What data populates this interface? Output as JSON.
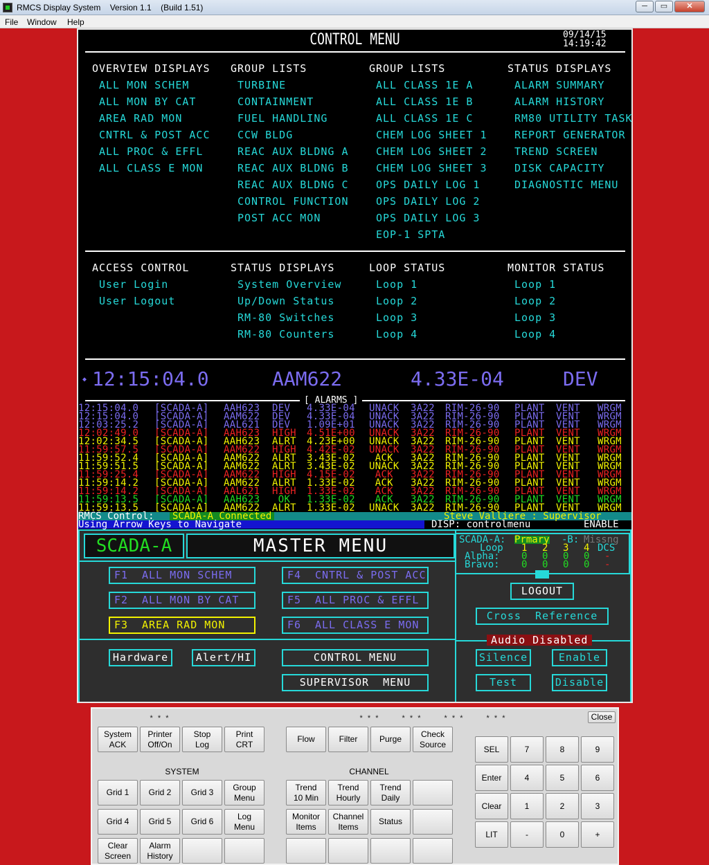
{
  "window": {
    "title": "RMCS Display System    Version 1.1    (Build 1.51)",
    "minimize": "─",
    "restore": "▭",
    "close": "✕"
  },
  "menu": [
    "File",
    "Window",
    "Help"
  ],
  "control": {
    "title": "CONTROL MENU",
    "date": "09/14/15",
    "time": "14:19:42",
    "columns": [
      {
        "header": "OVERVIEW DISPLAYS",
        "items": [
          "ALL MON SCHEM",
          "ALL MON BY CAT",
          "AREA RAD MON",
          "CNTRL & POST ACC",
          "ALL PROC & EFFL",
          "ALL CLASS E MON"
        ]
      },
      {
        "header": "GROUP LISTS",
        "items": [
          "TURBINE",
          "CONTAINMENT",
          "FUEL HANDLING",
          "CCW BLDG",
          "REAC AUX BLDNG A",
          "REAC AUX BLDNG B",
          "REAC AUX BLDNG C",
          "CONTROL FUNCTION",
          "POST ACC MON"
        ]
      },
      {
        "header": "GROUP LISTS",
        "items": [
          "ALL CLASS 1E A",
          "ALL CLASS 1E B",
          "ALL CLASS 1E C",
          "CHEM LOG SHEET 1",
          "CHEM LOG SHEET 2",
          "CHEM LOG SHEET 3",
          "OPS DAILY LOG 1",
          "OPS DAILY LOG 2",
          "OPS DAILY LOG 3",
          "EOP-1 SPTA"
        ]
      },
      {
        "header": "STATUS DISPLAYS",
        "items": [
          "ALARM SUMMARY",
          "ALARM HISTORY",
          "RM80 UTILITY TASK",
          "REPORT GENERATOR",
          "TREND SCREEN",
          "DISK CAPACITY",
          "DIAGNOSTIC MENU"
        ]
      }
    ],
    "columns2": [
      {
        "header": "ACCESS CONTROL",
        "items": [
          "User Login",
          "User Logout"
        ]
      },
      {
        "header": "STATUS DISPLAYS",
        "items": [
          "System Overview",
          "Up/Down Status",
          "RM-80 Switches",
          "RM-80 Counters"
        ]
      },
      {
        "header": "LOOP STATUS",
        "items": [
          "Loop 1",
          "Loop 2",
          "Loop 3",
          "Loop 4"
        ]
      },
      {
        "header": "MONITOR STATUS",
        "items": [
          "Loop 1",
          "Loop 2",
          "Loop 3",
          "Loop 4"
        ]
      }
    ]
  },
  "current": {
    "time": "12:15:04.0",
    "point": "AAM622",
    "value": "4.33E-04",
    "state": "DEV"
  },
  "alarms_title": "[ ALARMS ]",
  "alarms": [
    {
      "t": "12:15:04.0",
      "src": "[SCADA-A]",
      "pt": "AAH623",
      "st": "DEV ",
      "val": "4.33E-04",
      "ack": "UNACK",
      "ch": "3A22",
      "mon": "RIM-26-90",
      "a1": "PLANT",
      "a2": "VENT",
      "a3": "WRGM",
      "color": "#7b6cf0"
    },
    {
      "t": "12:15:04.0",
      "src": "[SCADA-A]",
      "pt": "AAM622",
      "st": "DEV ",
      "val": "4.33E-04",
      "ack": "UNACK",
      "ch": "3A22",
      "mon": "RIM-26-90",
      "a1": "PLANT",
      "a2": "VENT",
      "a3": "WRGM",
      "color": "#7b6cf0"
    },
    {
      "t": "12:03:25.2",
      "src": "[SCADA-A]",
      "pt": "AAL621",
      "st": "DEV ",
      "val": "1.09E+01",
      "ack": "UNACK",
      "ch": "3A22",
      "mon": "RIM-26-90",
      "a1": "PLANT",
      "a2": "VENT",
      "a3": "WRGM",
      "color": "#7b6cf0"
    },
    {
      "t": "12:02:49.0",
      "src": "[SCADA-A]",
      "pt": "AAH623",
      "st": "HIGH",
      "val": "4.51E+00",
      "ack": "UNACK",
      "ch": "3A22",
      "mon": "RIM-26-90",
      "a1": "PLANT",
      "a2": "VENT",
      "a3": "WRGM",
      "color": "#ee2222"
    },
    {
      "t": "12:02:34.5",
      "src": "[SCADA-A]",
      "pt": "AAH623",
      "st": "ALRT",
      "val": "4.23E+00",
      "ack": "UNACK",
      "ch": "3A22",
      "mon": "RIM-26-90",
      "a1": "PLANT",
      "a2": "VENT",
      "a3": "WRGM",
      "color": "#f2f200"
    },
    {
      "t": "11:59:57.5",
      "src": "[SCADA-A]",
      "pt": "AAM622",
      "st": "HIGH",
      "val": "4.42E-02",
      "ack": "UNACK",
      "ch": "3A22",
      "mon": "RIM-26-90",
      "a1": "PLANT",
      "a2": "VENT",
      "a3": "WRGM",
      "color": "#ee2222"
    },
    {
      "t": "11:59:52.4",
      "src": "[SCADA-A]",
      "pt": "AAM622",
      "st": "ALRT",
      "val": "3.43E-02",
      "ack": " ACK ",
      "ch": "3A22",
      "mon": "RIM-26-90",
      "a1": "PLANT",
      "a2": "VENT",
      "a3": "WRGM",
      "color": "#f2f200"
    },
    {
      "t": "11:59:51.5",
      "src": "[SCADA-A]",
      "pt": "AAM622",
      "st": "ALRT",
      "val": "3.43E-02",
      "ack": "UNACK",
      "ch": "3A22",
      "mon": "RIM-26-90",
      "a1": "PLANT",
      "a2": "VENT",
      "a3": "WRGM",
      "color": "#f2f200"
    },
    {
      "t": "11:59:25.4",
      "src": "[SCADA-A]",
      "pt": "AAM622",
      "st": "HIGH",
      "val": "4.15E-02",
      "ack": " ACK ",
      "ch": "3A22",
      "mon": "RIM-26-90",
      "a1": "PLANT",
      "a2": "VENT",
      "a3": "WRGM",
      "color": "#ee2222"
    },
    {
      "t": "11:59:14.2",
      "src": "[SCADA-A]",
      "pt": "AAM622",
      "st": "ALRT",
      "val": "1.33E-02",
      "ack": " ACK ",
      "ch": "3A22",
      "mon": "RIM-26-90",
      "a1": "PLANT",
      "a2": "VENT",
      "a3": "WRGM",
      "color": "#f2f200"
    },
    {
      "t": "11:59:14.2",
      "src": "[SCADA-A]",
      "pt": "AAL621",
      "st": "HIGH",
      "val": "1.33E-02",
      "ack": " ACK ",
      "ch": "3A22",
      "mon": "RIM-26-90",
      "a1": "PLANT",
      "a2": "VENT",
      "a3": "WRGM",
      "color": "#ee2222"
    },
    {
      "t": "11:59:13.5",
      "src": "[SCADA-A]",
      "pt": "AAH623",
      "st": " OK ",
      "val": "1.33E-02",
      "ack": " ACK ",
      "ch": "3A22",
      "mon": "RIM-26-90",
      "a1": "PLANT",
      "a2": "VENT",
      "a3": "WRGM",
      "color": "#22dd22"
    },
    {
      "t": "11:59:13.5",
      "src": "[SCADA-A]",
      "pt": "AAM622",
      "st": "ALRT",
      "val": "1.33E-02",
      "ack": "UNACK",
      "ch": "3A22",
      "mon": "RIM-26-90",
      "a1": "PLANT",
      "a2": "VENT",
      "a3": "WRGM",
      "color": "#f2f200"
    }
  ],
  "status": {
    "control": "RMCS Control:",
    "connected": "SCADA-A Connected",
    "user": "Steve Valliere : Supervisor",
    "hint": "Using Arrow Keys to Navigate",
    "disp": "DISP: controlmenu",
    "enable": "ENABLE"
  },
  "master": {
    "scada": "SCADA-A",
    "title": "MASTER MENU",
    "fkeys": [
      {
        "k": "F1",
        "label": "ALL MON SCHEM"
      },
      {
        "k": "F2",
        "label": "ALL MON BY CAT"
      },
      {
        "k": "F3",
        "label": "AREA RAD MON"
      },
      {
        "k": "F4",
        "label": "CNTRL & POST ACC"
      },
      {
        "k": "F5",
        "label": "ALL PROC & EFFL"
      },
      {
        "k": "F6",
        "label": "ALL CLASS E MON"
      }
    ],
    "hardware": "Hardware",
    "alert": "Alert/HI",
    "control_menu": "CONTROL MENU",
    "supervisor_menu": "SUPERVISOR  MENU",
    "logout": "LOGOUT",
    "cross_ref": "Cross  Reference",
    "audio": "Audio Disabled",
    "silence": "Silence",
    "enable": "Enable",
    "test": "Test",
    "disable": "Disable"
  },
  "scada_status": {
    "a_label": "SCADA-A:",
    "a_state": "Prmary",
    "b_label": "-B:",
    "b_state": "Missng",
    "loop_label": "Loop",
    "loops": [
      "1",
      "2",
      "3",
      "4"
    ],
    "dcs": "DCS",
    "alpha_label": "Alpha:",
    "alpha": [
      "0",
      "0",
      "0",
      "0"
    ],
    "alpha_dcs": "-",
    "bravo_label": "Bravo:",
    "bravo": [
      "0",
      "0",
      "0",
      "0"
    ],
    "bravo_dcs": "-"
  },
  "keyboard": {
    "close": "Close",
    "system_label": "SYSTEM",
    "channel_label": "CHANNEL",
    "dots": "* * *",
    "sys_top": [
      "System\nACK",
      "Printer\nOff/On",
      "Stop\nLog",
      "Print\nCRT"
    ],
    "ch_top": [
      "Flow",
      "Filter",
      "Purge",
      "Check\nSource"
    ],
    "sys_grid": [
      "Grid 1",
      "Grid 2",
      "Grid 3",
      "Group\nMenu",
      "Grid 4",
      "Grid 5",
      "Grid 6",
      "Log\nMenu",
      "Clear\nScreen",
      "Alarm\nHistory",
      "",
      ""
    ],
    "ch_grid": [
      "Trend\n10 Min",
      "Trend\nHourly",
      "Trend\nDaily",
      "",
      "Monitor\nItems",
      "Channel\nItems",
      "Status",
      "",
      "",
      "",
      "",
      ""
    ],
    "keypad": [
      "SEL",
      "7",
      "8",
      "9",
      "Enter",
      "4",
      "5",
      "6",
      "Clear",
      "1",
      "2",
      "3",
      "LIT",
      "-",
      "0",
      "+"
    ]
  }
}
